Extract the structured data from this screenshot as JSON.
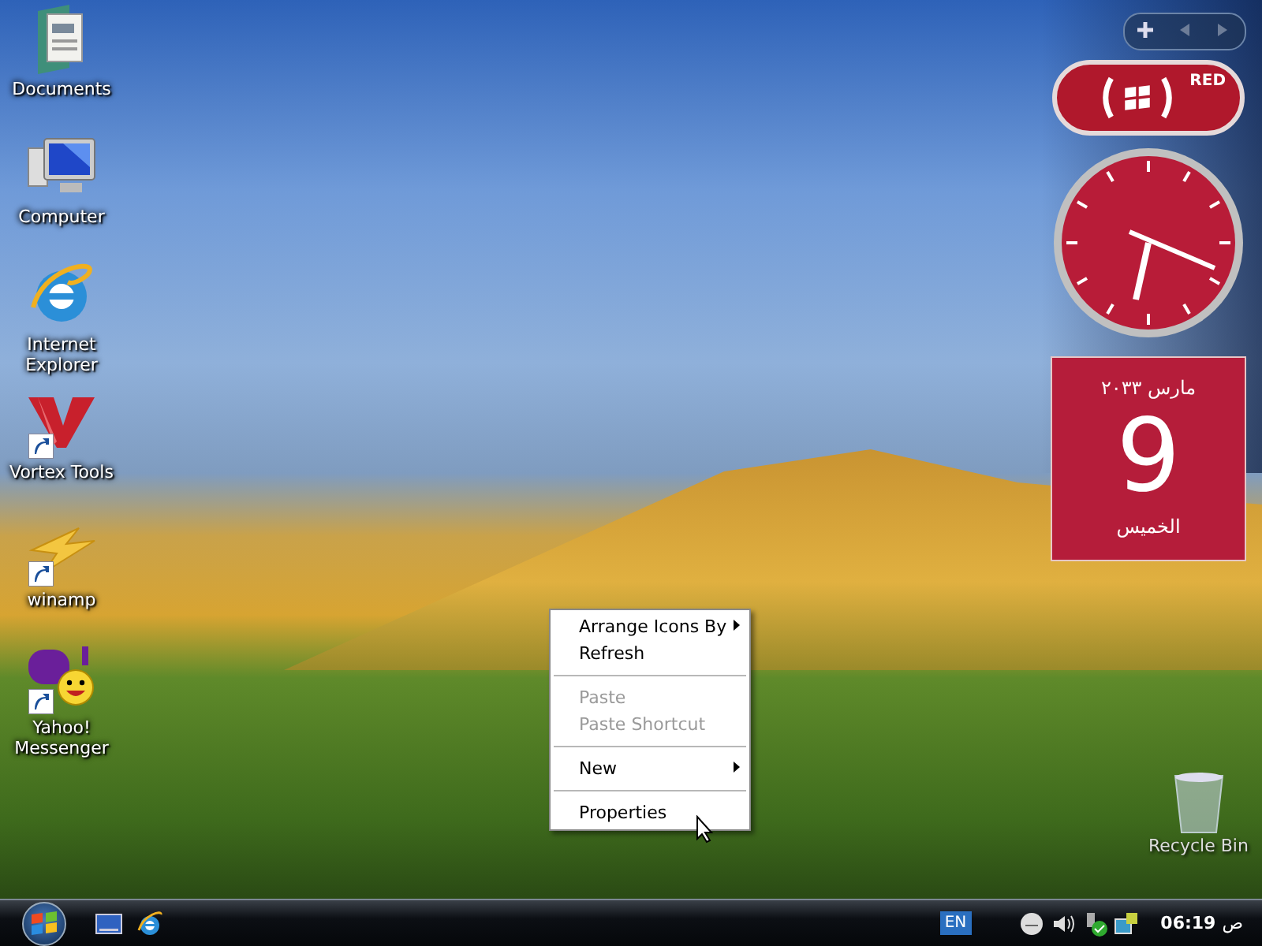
{
  "desktop_icons": [
    {
      "label": "Documents",
      "kind": "documents",
      "shortcut": false
    },
    {
      "label": "Computer",
      "kind": "computer",
      "shortcut": false
    },
    {
      "label": "Internet Explorer",
      "kind": "browser",
      "shortcut": false
    },
    {
      "label": "Vortex Tools",
      "kind": "vortex",
      "shortcut": true
    },
    {
      "label": "winamp",
      "kind": "winamp",
      "shortcut": true
    },
    {
      "label": "Yahoo! Messenger",
      "kind": "messenger",
      "shortcut": true
    }
  ],
  "gadgets": {
    "badge_text": "RED",
    "calendar": {
      "month_year": "مارس ٢٠٣٣",
      "day": "9",
      "weekday": "الخميس"
    }
  },
  "recycle_bin": {
    "label": "Recycle Bin"
  },
  "context_menu": [
    {
      "kind": "item",
      "label": "Arrange Icons By",
      "disabled": false,
      "submenu": true
    },
    {
      "kind": "item",
      "label": "Refresh",
      "disabled": false,
      "submenu": false
    },
    {
      "kind": "separator"
    },
    {
      "kind": "item",
      "label": "Paste",
      "disabled": true,
      "submenu": false
    },
    {
      "kind": "item",
      "label": "Paste Shortcut",
      "disabled": true,
      "submenu": false
    },
    {
      "kind": "separator"
    },
    {
      "kind": "item",
      "label": "New",
      "disabled": false,
      "submenu": true
    },
    {
      "kind": "separator"
    },
    {
      "kind": "item",
      "label": "Properties",
      "disabled": false,
      "submenu": false
    }
  ],
  "taskbar": {
    "quick_launch": [
      {
        "kind": "desktop"
      },
      {
        "kind": "browser"
      }
    ],
    "language": "EN",
    "time": "06:19",
    "period": "ص"
  }
}
